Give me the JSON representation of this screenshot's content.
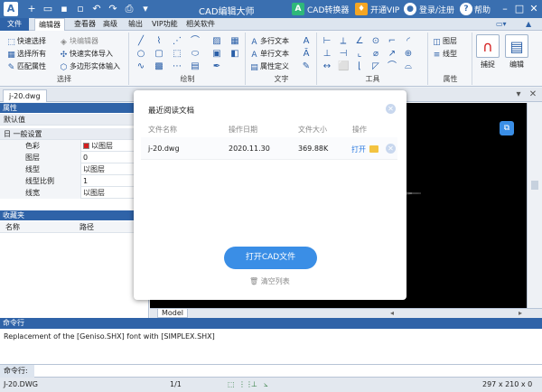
{
  "window": {
    "title": "CAD编辑大师",
    "converter_label": "CAD转换器",
    "vip_label": "开通VIP",
    "login_label": "登录/注册",
    "help_label": "帮助",
    "app_icon_letter": "A"
  },
  "menu": {
    "file": "文件",
    "tabs": [
      "编辑器",
      "查看器",
      "高级",
      "输出",
      "VIP功能",
      "相关软件"
    ]
  },
  "ribbon": {
    "select": {
      "label": "选择",
      "items": [
        "快速选择",
        "选择所有",
        "匹配属性"
      ],
      "items2": [
        "块编辑器",
        "快速实体导入",
        "多边形实体输入"
      ]
    },
    "draw": {
      "label": "绘制"
    },
    "text": {
      "label": "文字",
      "items": [
        "多行文本",
        "单行文本",
        "属性定义"
      ]
    },
    "tools": {
      "label": "工具"
    },
    "props": {
      "label": "属性",
      "items": [
        "图层",
        "线型"
      ]
    },
    "capture_label": "捕捉",
    "edit_label": "编辑"
  },
  "document": {
    "tab": "j-20.dwg"
  },
  "properties": {
    "header": "属性",
    "default": "默认值",
    "section": "日 一般设置",
    "rows": [
      {
        "key": "色彩",
        "value": "以图层"
      },
      {
        "key": "图层",
        "value": "0"
      },
      {
        "key": "线型",
        "value": "以图层"
      },
      {
        "key": "线型比例",
        "value": "1"
      },
      {
        "key": "线宽",
        "value": "以图层"
      }
    ]
  },
  "favorites": {
    "header": "收藏夹",
    "col_name": "名称",
    "col_path": "路径",
    "pin": "4"
  },
  "canvas": {
    "model_tab": "Model"
  },
  "recent_dialog": {
    "title": "最近阅读文档",
    "headers": {
      "name": "文件名称",
      "date": "操作日期",
      "size": "文件大小",
      "action": "操作"
    },
    "rows": [
      {
        "name": "j-20.dwg",
        "date": "2020.11.30",
        "size": "369.88K",
        "open": "打开"
      }
    ],
    "open_button": "打开CAD文件",
    "clear_button": "清空列表"
  },
  "command": {
    "header": "命令行",
    "log": "Replacement of the [Geniso.SHX] font with [SIMPLEX.SHX]",
    "input_label": "命令行:"
  },
  "status": {
    "file": "J-20.DWG",
    "page": "1/1",
    "dims": "297 x 210 x 0"
  },
  "colors": {
    "accent": "#2f63a8",
    "button": "#3a8ee6",
    "link": "#2d7be0",
    "color_swatch": "#d42020"
  }
}
